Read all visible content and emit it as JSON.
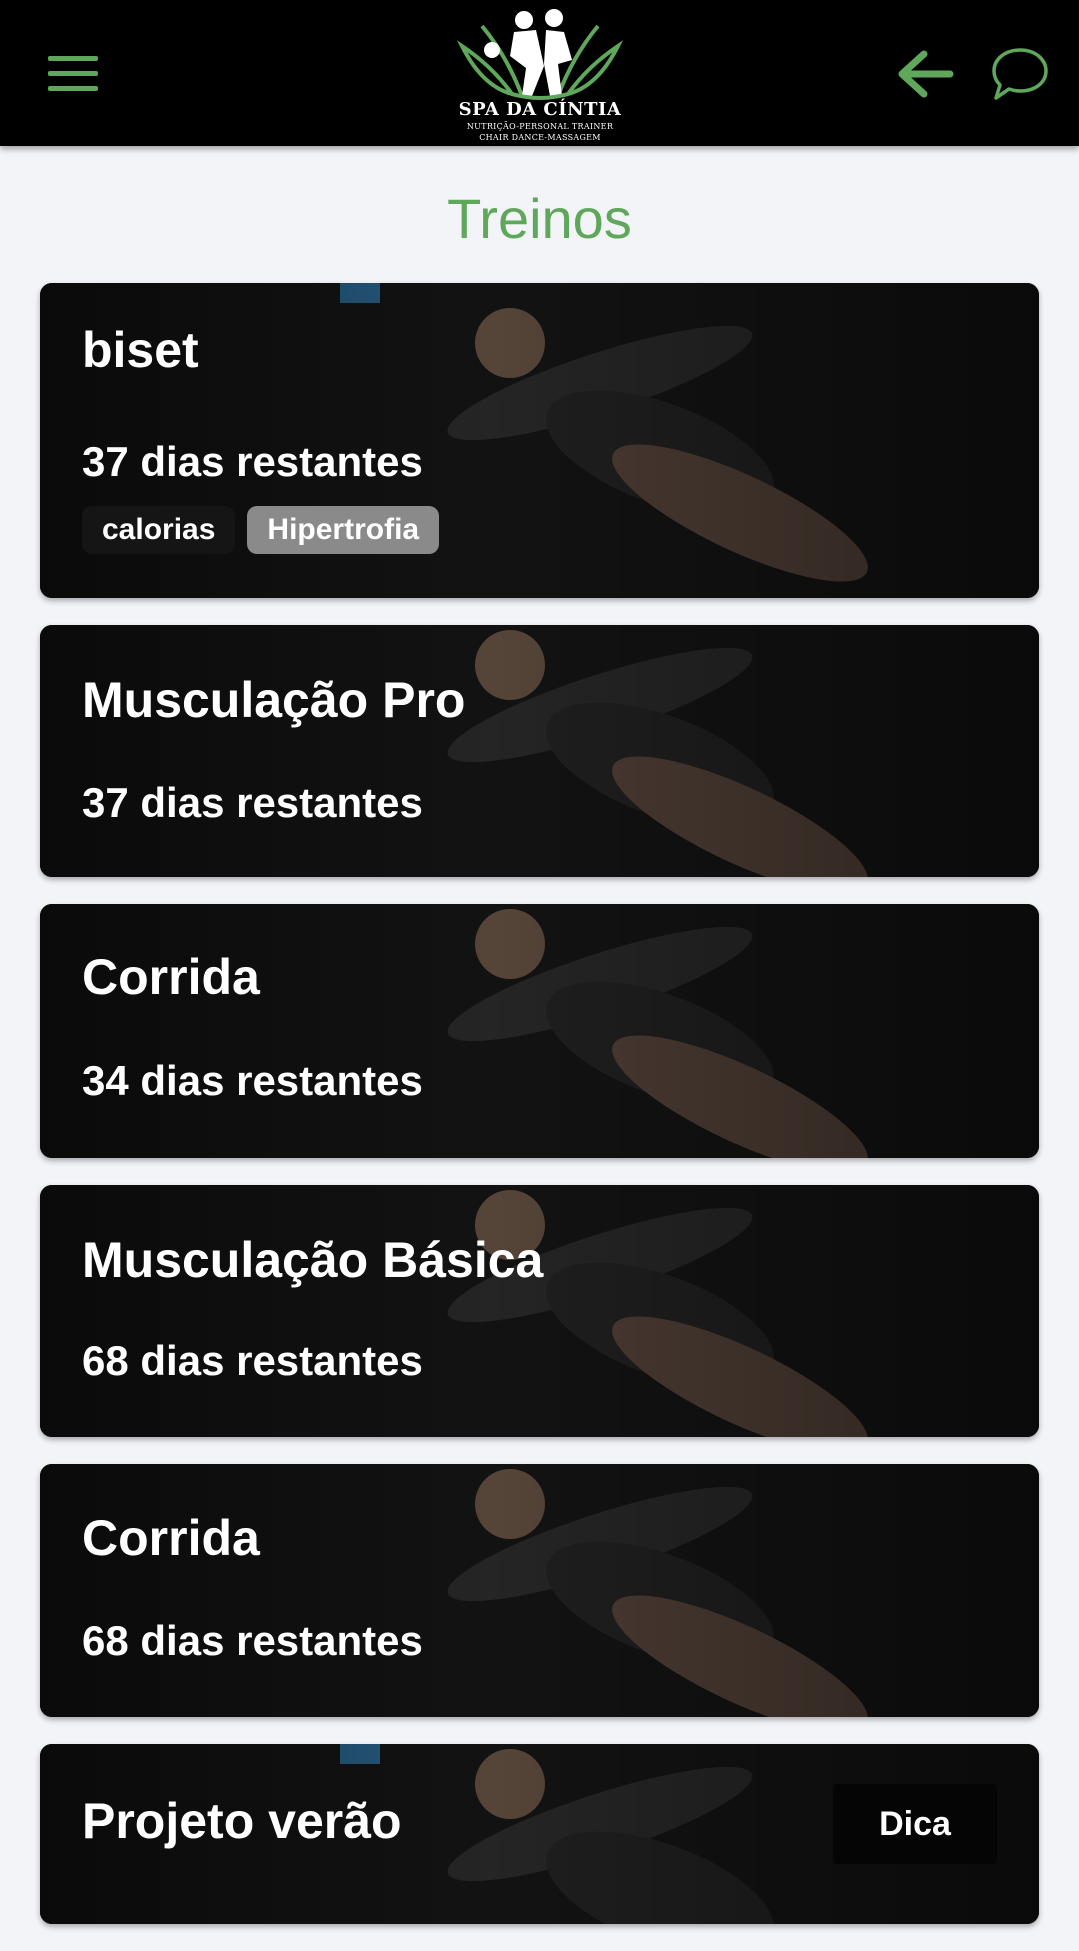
{
  "header": {
    "logo": {
      "brand": "SPA DA CÍNTIA",
      "line1": "NUTRIÇÃO-PERSONAL TRAINER",
      "line2": "CHAIR DANCE-MASSAGEM"
    },
    "icons": {
      "menu": "hamburger-menu-icon",
      "back": "arrow-left-icon",
      "chat": "chat-bubble-icon"
    },
    "accent_color": "#5fa75a"
  },
  "page": {
    "title": "Treinos"
  },
  "workouts": [
    {
      "title": "biset",
      "days": "37 dias restantes",
      "tags": [
        "calorias",
        "Hipertrofia"
      ]
    },
    {
      "title": "Musculação Pro",
      "days": "37 dias restantes"
    },
    {
      "title": "Corrida",
      "days": "34 dias restantes"
    },
    {
      "title": "Musculação Básica",
      "days": "68 dias restantes"
    },
    {
      "title": "Corrida",
      "days": "68 dias restantes"
    },
    {
      "title": "Projeto verão",
      "badge": "Dica"
    }
  ]
}
